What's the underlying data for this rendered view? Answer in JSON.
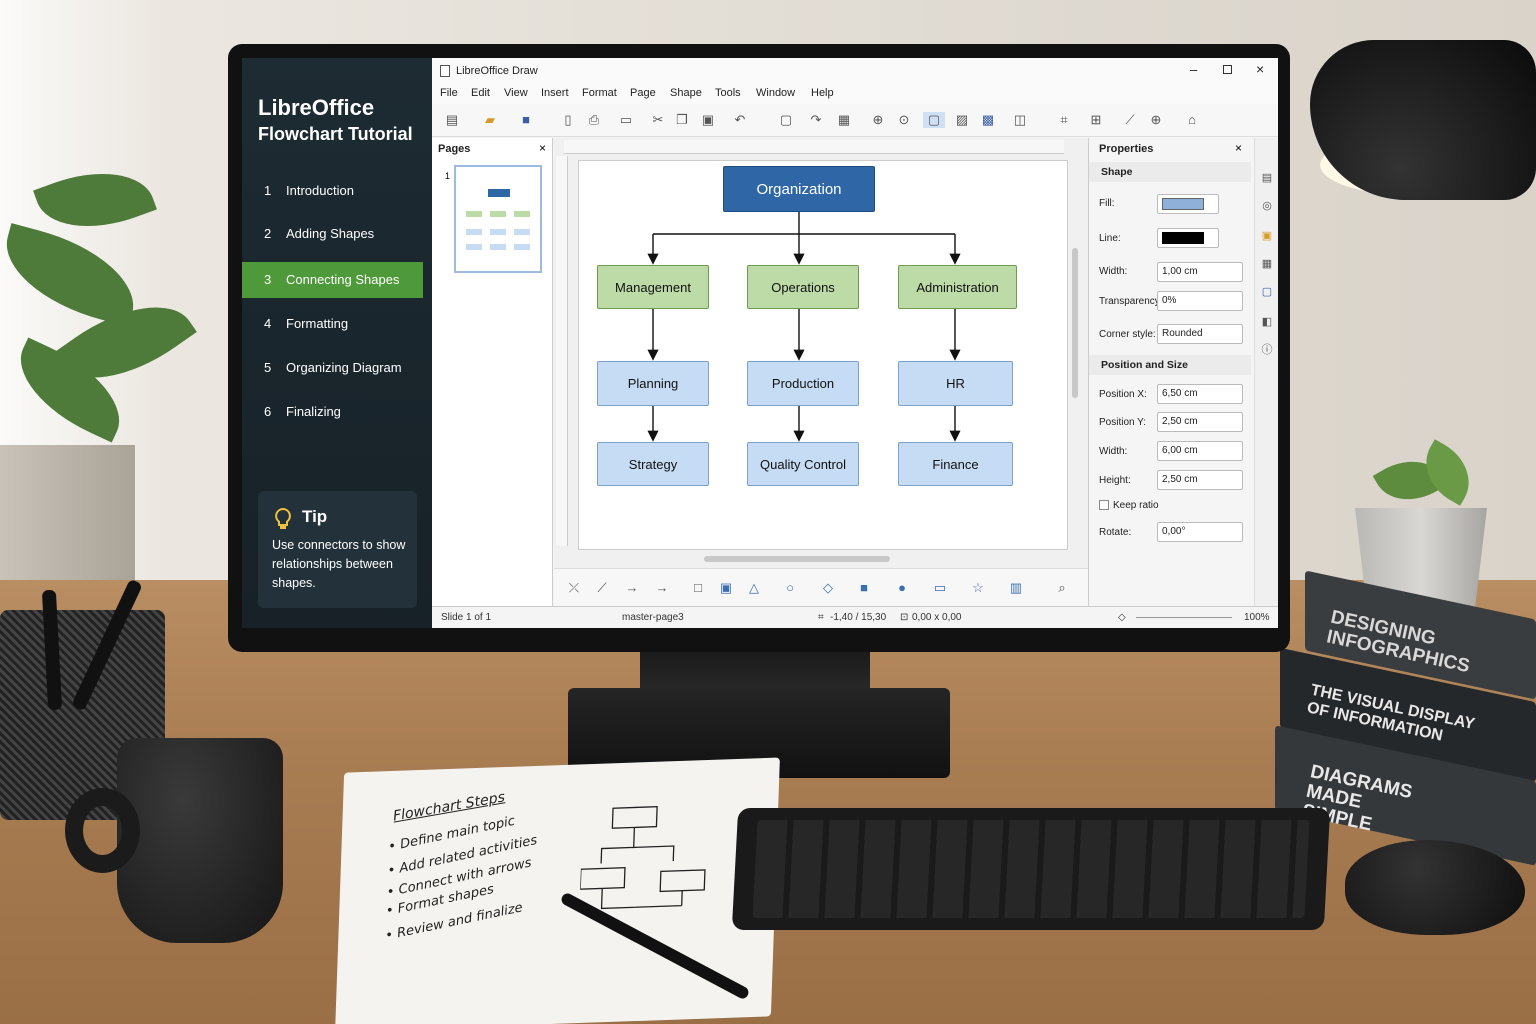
{
  "tutorial": {
    "title_line1": "LibreOffice",
    "title_line2": "Flowchart Tutorial",
    "items": [
      {
        "num": "1",
        "label": "Introduction"
      },
      {
        "num": "2",
        "label": "Adding Shapes"
      },
      {
        "num": "3",
        "label": "Connecting Shapes"
      },
      {
        "num": "4",
        "label": "Formatting"
      },
      {
        "num": "5",
        "label": "Organizing Diagram"
      },
      {
        "num": "6",
        "label": "Finalizing"
      }
    ],
    "active_index": 2,
    "tip_heading": "Tip",
    "tip_text": "Use connectors to show relationships between shapes."
  },
  "app": {
    "window_title": "LibreOffice Draw",
    "menu": [
      "File",
      "Edit",
      "View",
      "Insert",
      "Format",
      "Page",
      "Shape",
      "Tools",
      "Window",
      "Help"
    ],
    "pages_panel": {
      "title": "Pages",
      "page_number": "1"
    },
    "diagram": {
      "top": "Organization",
      "level2": [
        "Management",
        "Operations",
        "Administration"
      ],
      "level3": [
        "Planning",
        "Production",
        "HR"
      ],
      "level4": [
        "Strategy",
        "Quality Control",
        "Finance"
      ]
    },
    "properties": {
      "title": "Properties",
      "shape_section": "Shape",
      "fill_label": "Fill:",
      "fill_color": "#8fb0d8",
      "line_label": "Line:",
      "line_color": "#000000",
      "width_label": "Width:",
      "width_value": "1,00 cm",
      "transparency_label": "Transparency:",
      "transparency_value": "0%",
      "corner_label": "Corner style:",
      "corner_value": "Rounded",
      "pos_section": "Position and Size",
      "posx_label": "Position X:",
      "posx_value": "6,50 cm",
      "posy_label": "Position Y:",
      "posy_value": "2,50 cm",
      "w_label": "Width:",
      "w_value": "6,00 cm",
      "h_label": "Height:",
      "h_value": "2,50 cm",
      "keep_ratio": "Keep ratio",
      "rotate_label": "Rotate:",
      "rotate_value": "0,00°"
    },
    "status": {
      "slide": "Slide 1 of 1",
      "master": "master-page3",
      "position": "-1,40 / 15,30",
      "size": "0,00 x 0,00",
      "zoom": "100%"
    }
  },
  "books": [
    "DESIGNING INFOGRAPHICS",
    "THE VISUAL DISPLAY OF INFORMATION",
    "DIAGRAMS MADE SIMPLE"
  ],
  "notebook": {
    "heading": "Flowchart Steps",
    "steps": [
      "Define main topic",
      "Add related activities",
      "Connect with arrows",
      "Format shapes",
      "Review and finalize"
    ]
  }
}
